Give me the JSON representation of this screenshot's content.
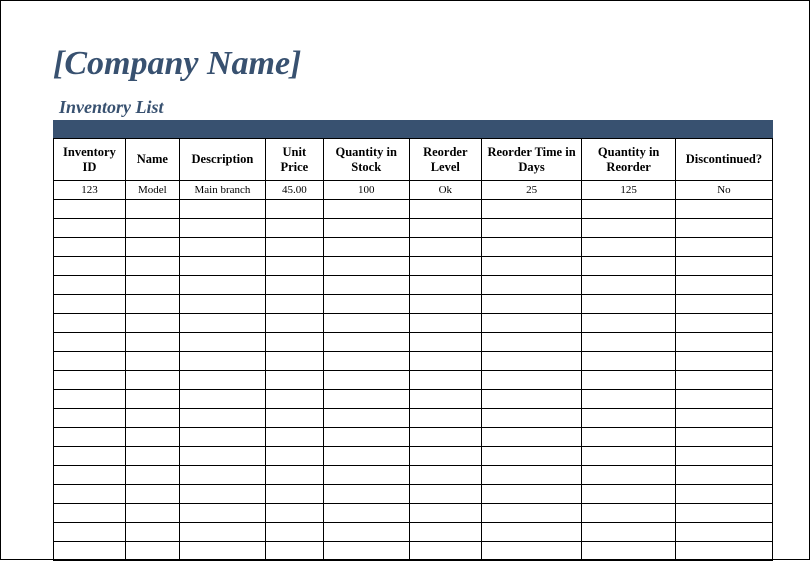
{
  "header": {
    "company_name": "[Company Name]",
    "list_title": "Inventory List"
  },
  "table": {
    "columns": [
      "Inventory ID",
      "Name",
      "Description",
      "Unit Price",
      "Quantity in Stock",
      "Reorder Level",
      "Reorder Time in Days",
      "Quantity in Reorder",
      "Discontinued?"
    ],
    "rows": [
      {
        "id": "123",
        "name": "Model",
        "description": "Main branch",
        "unit_price": "45.00",
        "qty_stock": "100",
        "reorder_level": "Ok",
        "reorder_time": "25",
        "qty_reorder": "125",
        "discontinued": "No"
      }
    ],
    "empty_row_count": 19
  }
}
